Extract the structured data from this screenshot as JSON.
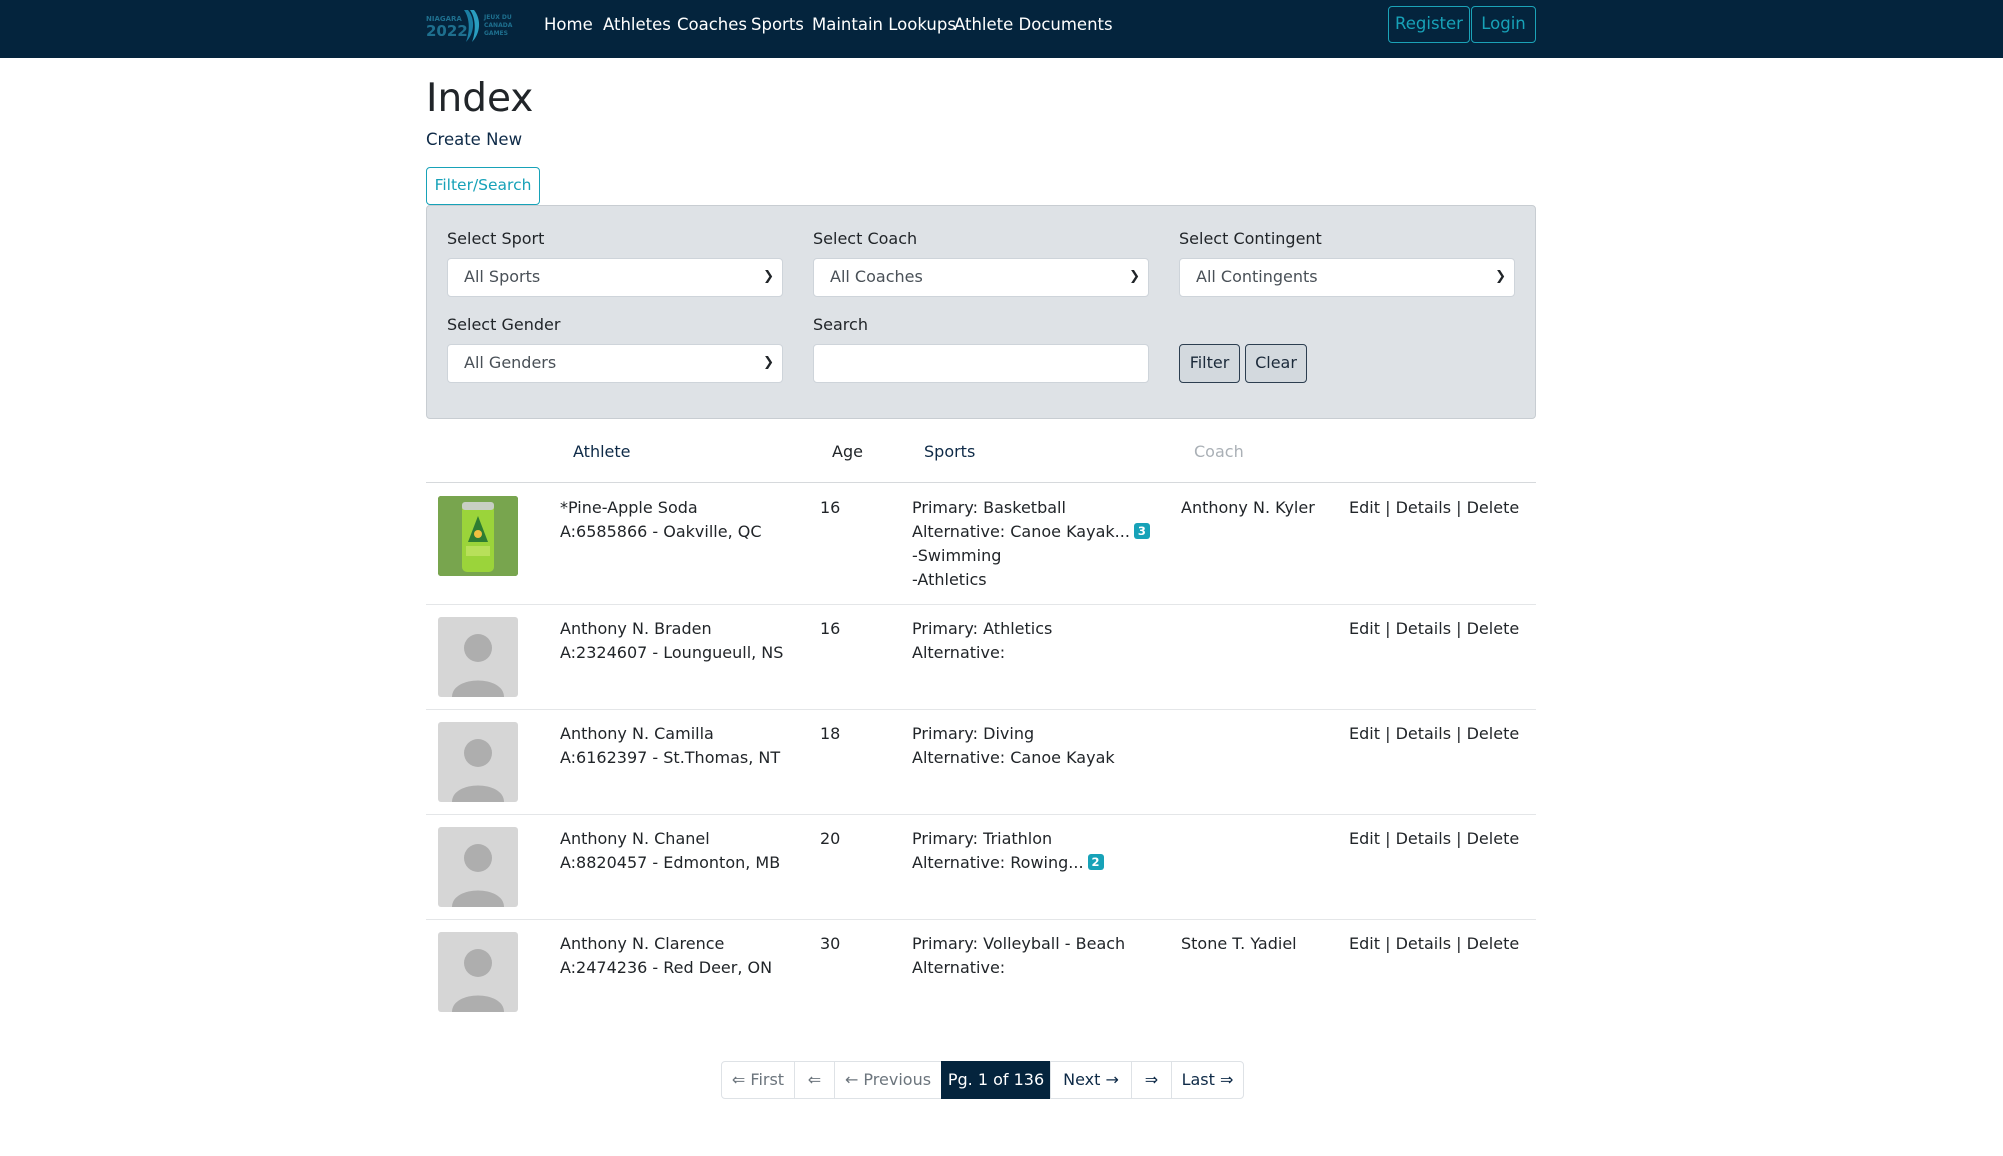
{
  "navbar": {
    "logo_text": "NIAGARA 2022 CANADA GAMES",
    "links": [
      "Home",
      "Athletes",
      "Coaches",
      "Sports",
      "Maintain Lookups",
      "Athlete Documents"
    ],
    "register_label": "Register",
    "login_label": "Login",
    "accent_color": "#17a2b8",
    "background_color": "#04243d"
  },
  "page": {
    "title": "Index",
    "create_new": "Create New",
    "filter_toggle": "Filter/Search"
  },
  "filters": {
    "sport": {
      "label": "Select Sport",
      "value": "All Sports"
    },
    "coach": {
      "label": "Select Coach",
      "value": "All Coaches"
    },
    "contingent": {
      "label": "Select Contingent",
      "value": "All Contingents"
    },
    "gender": {
      "label": "Select Gender",
      "value": "All Genders"
    },
    "search": {
      "label": "Search",
      "value": ""
    },
    "filter_button": "Filter",
    "clear_button": "Clear"
  },
  "table": {
    "headers": {
      "athlete": "Athlete",
      "age": "Age",
      "sports": "Sports",
      "coach": "Coach"
    },
    "rows": [
      {
        "photo": "soda-can-photo",
        "name": "*Pine-Apple Soda",
        "id_location": "A:6585866 - Oakville, QC",
        "age": "16",
        "primary": "Primary: Basketball",
        "alternative": "Alternative: Canoe Kayak...",
        "alt_count": "3",
        "extra": [
          "-Swimming",
          "-Athletics"
        ],
        "coach": "Anthony N. Kyler"
      },
      {
        "photo": "avatar-placeholder",
        "name": "Anthony N. Braden",
        "id_location": "A:2324607 - Loungueull, NS",
        "age": "16",
        "primary": "Primary: Athletics",
        "alternative": "Alternative:",
        "coach": ""
      },
      {
        "photo": "avatar-placeholder",
        "name": "Anthony N. Camilla",
        "id_location": "A:6162397 - St.Thomas, NT",
        "age": "18",
        "primary": "Primary: Diving",
        "alternative": "Alternative: Canoe Kayak",
        "coach": ""
      },
      {
        "photo": "avatar-placeholder",
        "name": "Anthony N. Chanel",
        "id_location": "A:8820457 - Edmonton, MB",
        "age": "20",
        "primary": "Primary: Triathlon",
        "alternative": "Alternative: Rowing...",
        "alt_count": "2",
        "coach": ""
      },
      {
        "photo": "avatar-placeholder",
        "name": "Anthony N. Clarence",
        "id_location": "A:2474236 - Red Deer, ON",
        "age": "30",
        "primary": "Primary: Volleyball - Beach",
        "alternative": "Alternative:",
        "coach": "Stone T. Yadiel"
      }
    ],
    "actions": {
      "edit": "Edit",
      "details": "Details",
      "delete": "Delete",
      "separator": "|"
    }
  },
  "pagination": {
    "first": "⇐ First",
    "prev_arrow": "⇐",
    "previous": "← Previous",
    "current": "Pg. 1 of 136",
    "next": "Next →",
    "next_arrow": "⇒",
    "last": "Last ⇒"
  }
}
